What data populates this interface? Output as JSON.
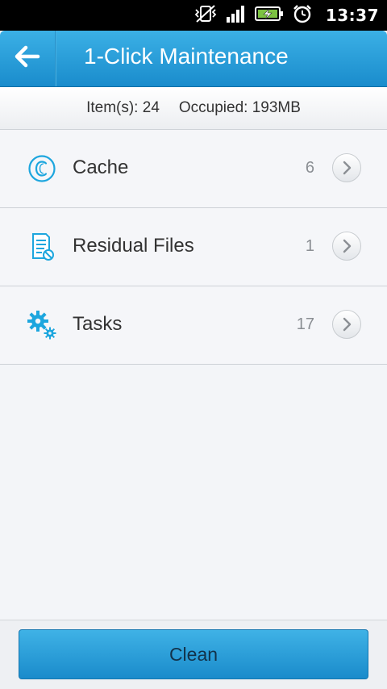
{
  "status_bar": {
    "time": "13:37",
    "icons": [
      "vibrate-off-icon",
      "signal-icon",
      "battery-charging-icon",
      "alarm-icon"
    ]
  },
  "header": {
    "title": "1-Click Maintenance",
    "back_icon": "back-arrow-icon"
  },
  "summary": {
    "items_label": "Item(s):",
    "items_value": "24",
    "occupied_label": "Occupied:",
    "occupied_value": "193MB"
  },
  "list": {
    "items": [
      {
        "label": "Cache",
        "count": "6",
        "icon": "cache-icon"
      },
      {
        "label": "Residual Files",
        "count": "1",
        "icon": "residual-files-icon"
      },
      {
        "label": "Tasks",
        "count": "17",
        "icon": "gears-icon"
      }
    ]
  },
  "actions": {
    "clean_label": "Clean"
  },
  "colors": {
    "accent": "#1a8ccc",
    "icon": "#1da6de"
  }
}
